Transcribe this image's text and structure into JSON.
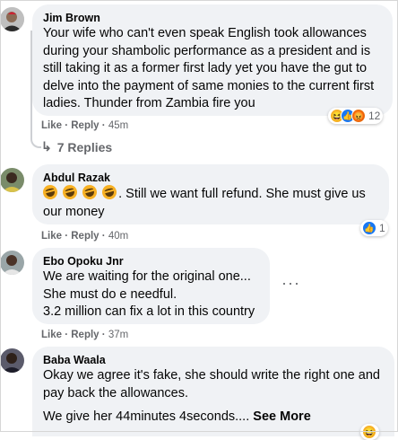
{
  "comments": [
    {
      "author": "Jim Brown",
      "text": "Your wife who can't even speak English took allowances during your shambolic performance as a president and is still taking it as a former first lady yet you have the gut to delve into the payment of same monies to the current first ladies. Thunder from Zambia fire you",
      "like": "Like",
      "reply": "Reply",
      "time": "45m",
      "reaction_count": "12",
      "reactions": [
        "haha",
        "like",
        "angry"
      ],
      "replies_label": "7 Replies"
    },
    {
      "author": "Abdul Razak",
      "text": ". Still we want full refund. She must give us our money",
      "emojis": [
        "laugh",
        "laugh",
        "laugh",
        "laugh"
      ],
      "like": "Like",
      "reply": "Reply",
      "time": "40m",
      "reaction_count": "1",
      "reactions": [
        "like"
      ]
    },
    {
      "author": "Ebo Opoku Jnr",
      "lines": [
        "We are waiting for the original one...",
        "She must do e needful.",
        "3.2 million can fix a lot in this country"
      ],
      "like": "Like",
      "reply": "Reply",
      "time": "37m"
    },
    {
      "author": "Baba Waala",
      "lines": [
        "Okay we agree it's fake, she should write the right one and pay back the allowances."
      ],
      "line2": "We give her 44minutes 4seconds....",
      "see_more": "See More"
    }
  ],
  "colors": {
    "bubble": "#f0f2f5",
    "secondary": "#65676b",
    "like_blue": "#1877f2",
    "haha": "#f7b125",
    "angry": "#e9710f"
  }
}
